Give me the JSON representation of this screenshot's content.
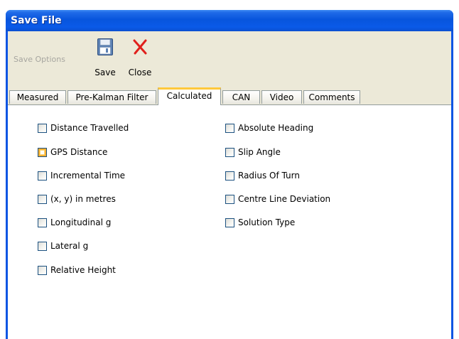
{
  "window": {
    "title": "Save File"
  },
  "toolbar": {
    "group_label": "Save Options",
    "save_label": "Save",
    "close_label": "Close"
  },
  "tabs": [
    {
      "label": "Measured",
      "active": false
    },
    {
      "label": "Pre-Kalman Filter",
      "active": false
    },
    {
      "label": "Calculated",
      "active": true
    },
    {
      "label": "CAN",
      "active": false
    },
    {
      "label": "Video",
      "active": false
    },
    {
      "label": "Comments",
      "active": false
    }
  ],
  "calculated": {
    "left_column": [
      {
        "label": "Distance Travelled",
        "checked": false
      },
      {
        "label": "GPS Distance",
        "checked": false,
        "hover": true
      },
      {
        "label": "Incremental Time",
        "checked": false
      },
      {
        "label": "(x, y) in metres",
        "checked": false
      },
      {
        "label": "Longitudinal g",
        "checked": false
      },
      {
        "label": "Lateral g",
        "checked": false
      },
      {
        "label": "Relative Height",
        "checked": false
      }
    ],
    "right_column": [
      {
        "label": "Absolute Heading",
        "checked": false
      },
      {
        "label": "Slip Angle",
        "checked": false
      },
      {
        "label": "Radius Of Turn",
        "checked": false
      },
      {
        "label": "Centre Line Deviation",
        "checked": false
      },
      {
        "label": "Solution Type",
        "checked": false
      }
    ]
  },
  "colors": {
    "titlebar": "#0855dd",
    "toolbar_bg": "#ece9d8",
    "active_tab_accent": "#ffc83c",
    "close_icon": "#e0201c"
  }
}
